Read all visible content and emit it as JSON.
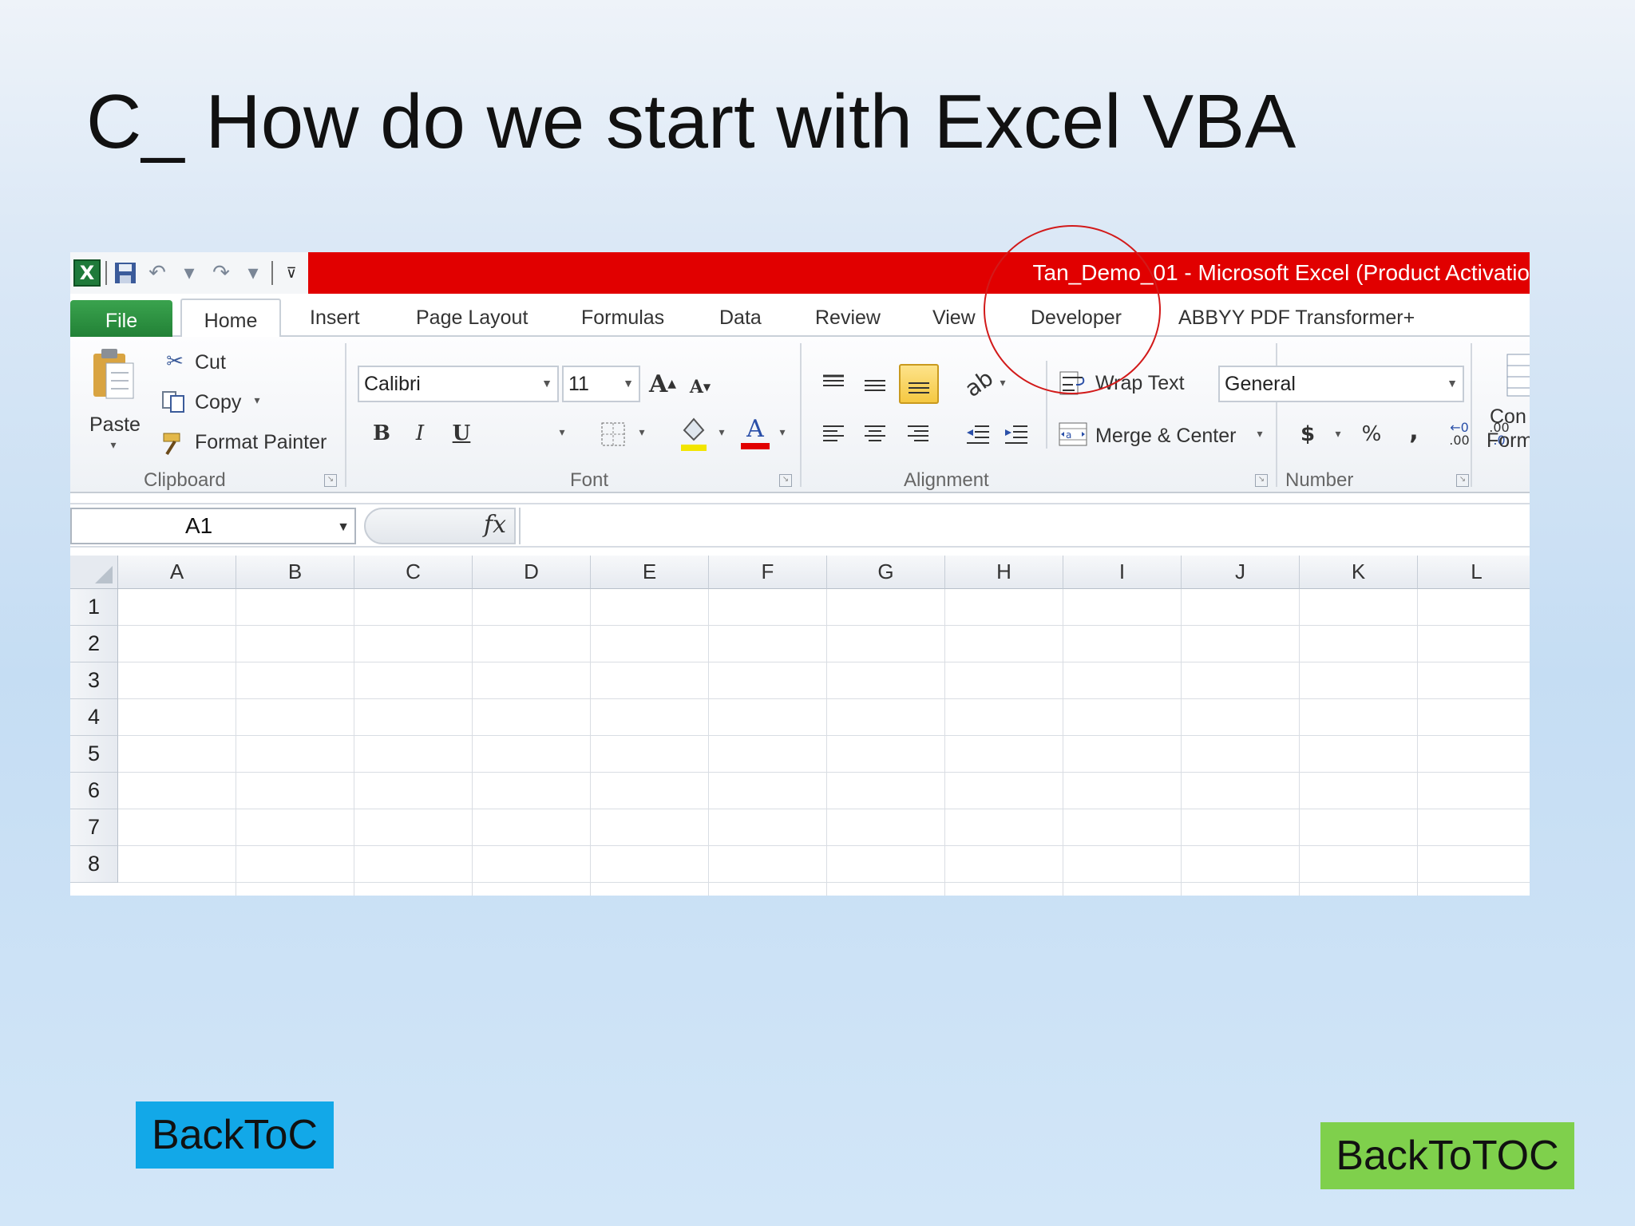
{
  "slide": {
    "title": "C_ How do we start with Excel VBA"
  },
  "excel": {
    "window_title": "Tan_Demo_01  -  Microsoft Excel (Product Activatio",
    "qat_icons": [
      "excel-logo-icon",
      "save-icon",
      "undo-icon",
      "redo-icon",
      "customize-qat-icon"
    ],
    "tabs": [
      "File",
      "Home",
      "Insert",
      "Page Layout",
      "Formulas",
      "Data",
      "Review",
      "View",
      "Developer",
      "ABBYY PDF Transformer+"
    ],
    "active_tab": "Home",
    "ribbon": {
      "clipboard": {
        "paste": "Paste",
        "cut": "Cut",
        "copy": "Copy",
        "format_painter": "Format Painter",
        "label": "Clipboard"
      },
      "font": {
        "font_name": "Calibri",
        "font_size": "11",
        "label": "Font",
        "bold": "B",
        "italic": "I",
        "underline": "U",
        "grow": "A",
        "shrink": "A",
        "font_color": "A"
      },
      "alignment": {
        "wrap_text": "Wrap Text",
        "merge_center": "Merge & Center",
        "label": "Alignment"
      },
      "number": {
        "format": "General",
        "currency": "$",
        "percent": "%",
        "comma": ",",
        "inc_decimal": ".00",
        "dec_decimal": ".0",
        "label": "Number"
      },
      "styles": {
        "cond_format_line1": "Con",
        "cond_format_line2": "Form"
      }
    },
    "formula_bar": {
      "name_box": "A1",
      "fx": "fx",
      "value": ""
    },
    "columns": [
      "A",
      "B",
      "C",
      "D",
      "E",
      "F",
      "G",
      "H",
      "I",
      "J",
      "K",
      "L"
    ],
    "rows": [
      "1",
      "2",
      "3",
      "4",
      "5",
      "6",
      "7",
      "8"
    ],
    "annotation_color": "#d21a1a"
  },
  "buttons": {
    "back_toc": "BackToC",
    "back_to_toc": "BackToTOC"
  }
}
